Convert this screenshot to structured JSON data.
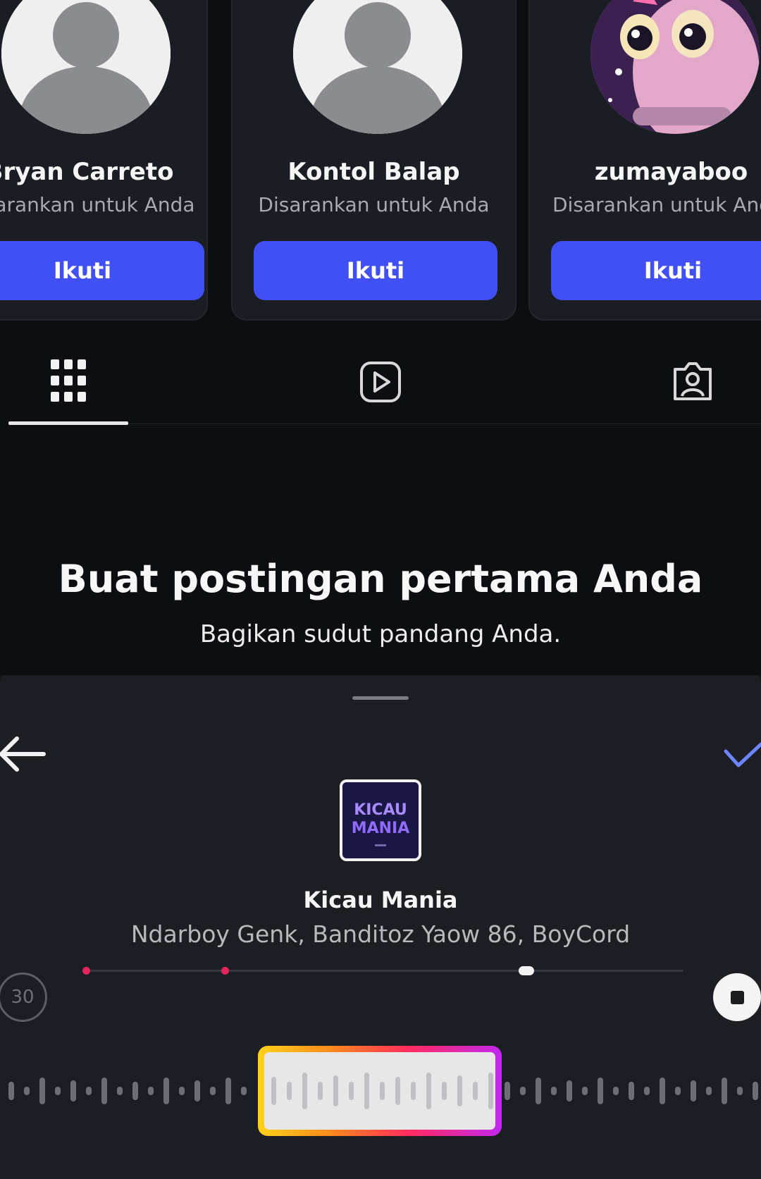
{
  "suggestions": {
    "cards": [
      {
        "name": "Bryan Carreto",
        "subtitle": "Disarankan untuk Anda",
        "follow_label": "Ikuti",
        "avatar": "default-avatar"
      },
      {
        "name": "Kontol Balap",
        "subtitle": "Disarankan untuk Anda",
        "follow_label": "Ikuti",
        "avatar": "default-avatar"
      },
      {
        "name": "zumayaboo",
        "subtitle": "Disarankan untuk Anda",
        "follow_label": "Ikuti",
        "avatar": "anime-avatar"
      }
    ]
  },
  "tabs": {
    "items": [
      {
        "icon": "grid-icon",
        "active": true
      },
      {
        "icon": "reels-icon",
        "active": false
      },
      {
        "icon": "tagged-icon",
        "active": false
      }
    ]
  },
  "empty_state": {
    "title": "Buat postingan pertama Anda",
    "subtitle": "Bagikan sudut pandang Anda."
  },
  "music_sheet": {
    "song_title": "Kicau Mania",
    "artists": "Ndarboy Genk, Banditoz Yaow 86, BoyCord",
    "duration_label": "30",
    "back_icon": "arrow-left-icon",
    "confirm_icon": "check-icon",
    "stop_icon": "stop-icon",
    "accent_colors": [
      "#ffd21a",
      "#ff8a1c",
      "#ff2b5e",
      "#c228f0"
    ]
  }
}
